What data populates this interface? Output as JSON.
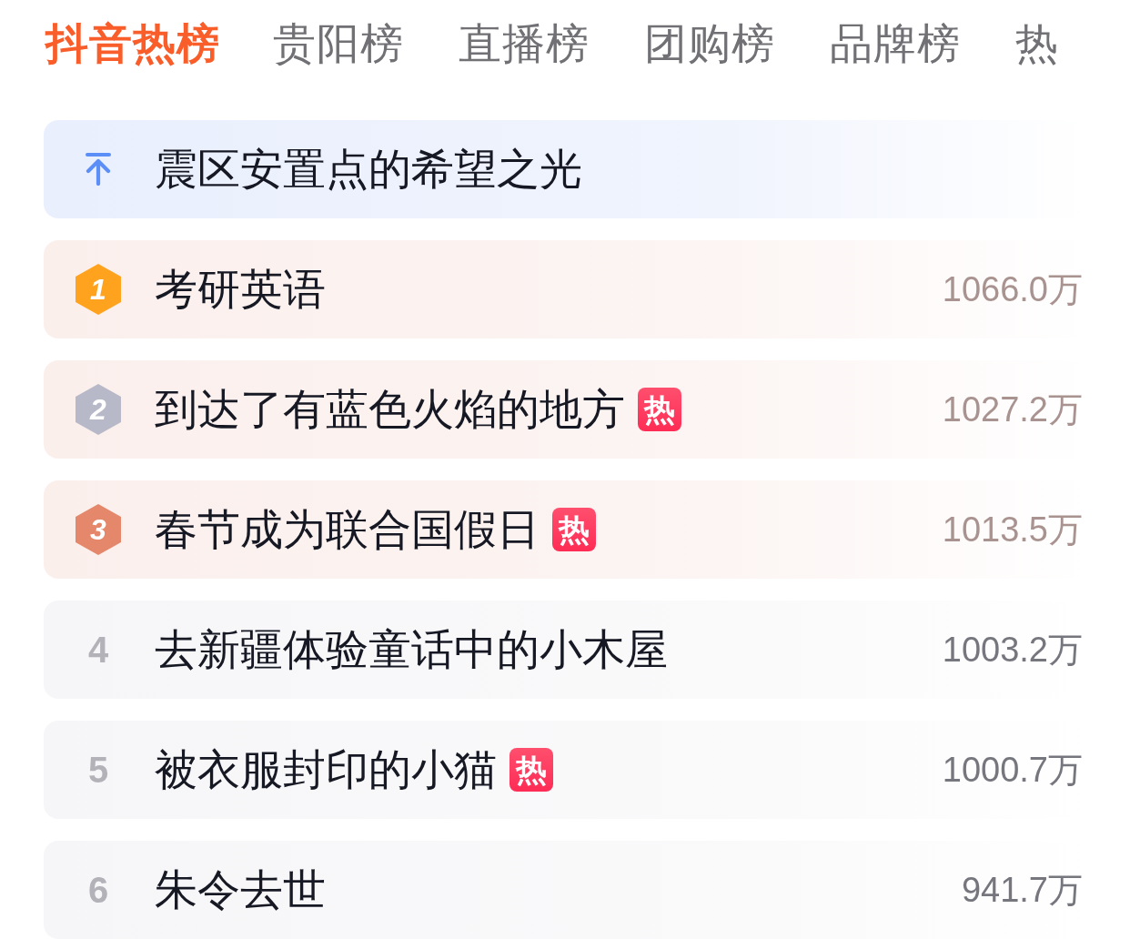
{
  "tabs": [
    {
      "label": "抖音热榜",
      "selected": true
    },
    {
      "label": "贵阳榜",
      "selected": false
    },
    {
      "label": "直播榜",
      "selected": false
    },
    {
      "label": "团购榜",
      "selected": false
    },
    {
      "label": "品牌榜",
      "selected": false
    },
    {
      "label": "热",
      "selected": false
    }
  ],
  "pinned": {
    "title": "震区安置点的希望之光"
  },
  "items": [
    {
      "kind": "medal",
      "rank": "1",
      "color": "#ffa31f",
      "title": "考研英语",
      "heat": "1066.0万"
    },
    {
      "kind": "medal",
      "rank": "2",
      "color": "#b8b9c8",
      "title": "到达了有蓝色火焰的地方",
      "tag": "热",
      "heat": "1027.2万"
    },
    {
      "kind": "medal",
      "rank": "3",
      "color": "#e4876b",
      "title": "春节成为联合国假日",
      "tag": "热",
      "heat": "1013.5万"
    },
    {
      "kind": "plain",
      "rank": "4",
      "title": "去新疆体验童话中的小木屋",
      "heat": "1003.2万"
    },
    {
      "kind": "plain",
      "rank": "5",
      "title": "被衣服封印的小猫",
      "tag": "热",
      "heat": "1000.7万"
    },
    {
      "kind": "plain",
      "rank": "6",
      "title": "朱令去世",
      "heat": "941.7万"
    }
  ]
}
